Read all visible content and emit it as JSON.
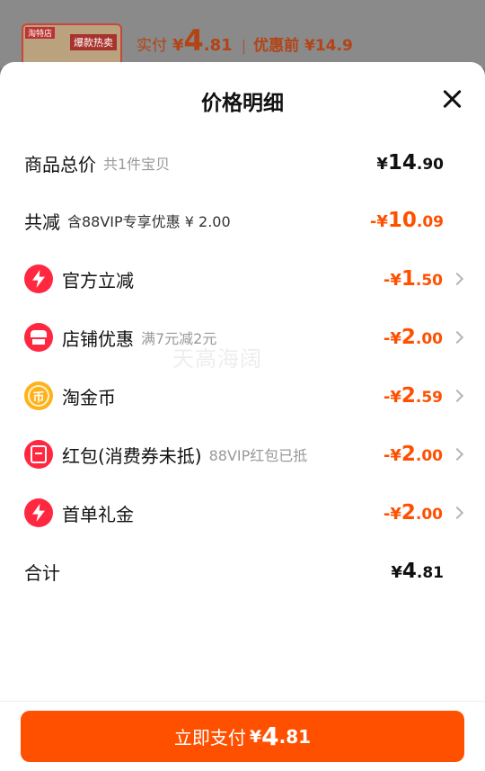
{
  "background": {
    "thumb_tag": "淘特店",
    "thumb_badge": "爆款热卖",
    "paid_label": "实付",
    "paid_yen": "¥",
    "paid_int": "4",
    "paid_dec": ".81",
    "separator": "|",
    "before_label": "优惠前 ¥14.9"
  },
  "sheet": {
    "title": "价格明细",
    "watermark": "天高海阔"
  },
  "rows": {
    "total": {
      "label": "商品总价",
      "sub": "共1件宝贝",
      "prefix": "¥",
      "int": "14",
      "dec": ".90"
    },
    "reduce": {
      "label": "共减",
      "sub": "含88VIP专享优惠 ¥ 2.00",
      "prefix": "-¥",
      "int": "10",
      "dec": ".09"
    },
    "official": {
      "label": "官方立减",
      "prefix": "-¥",
      "int": "1",
      "dec": ".50",
      "icon": "bolt-icon"
    },
    "shop": {
      "label": "店铺优惠",
      "sub": "满7元减2元",
      "prefix": "-¥",
      "int": "2",
      "dec": ".00",
      "icon": "shop-icon"
    },
    "coin": {
      "label": "淘金币",
      "prefix": "-¥",
      "int": "2",
      "dec": ".59",
      "icon": "coin-icon",
      "glyph": "币"
    },
    "redpacket": {
      "label": "红包(消费券未抵)",
      "sub": "88VIP红包已抵",
      "prefix": "-¥",
      "int": "2",
      "dec": ".00",
      "icon": "red-packet-icon"
    },
    "firstorder": {
      "label": "首单礼金",
      "prefix": "-¥",
      "int": "2",
      "dec": ".00",
      "icon": "bolt-icon"
    },
    "sum": {
      "label": "合计",
      "prefix": "¥",
      "int": "4",
      "dec": ".81"
    }
  },
  "pay": {
    "label": "立即支付",
    "yen": "¥",
    "int": "4",
    "dec": ".81"
  },
  "colors": {
    "accent": "#ff5000",
    "icon_red": "#ff2840",
    "icon_gold": "#ffb11b"
  }
}
